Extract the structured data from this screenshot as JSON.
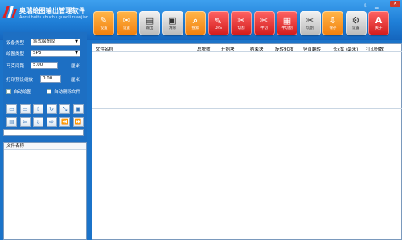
{
  "app": {
    "title": "奥瑞绘图输出管理软件",
    "subtitle": "Aorui huitu shuchu guanli ruanjian"
  },
  "window": {
    "close_label": "✕",
    "minimize_label": "▁",
    "extra_label": "⇩"
  },
  "toolbar": [
    {
      "label": "设置",
      "icon": "✎",
      "color": "orange"
    },
    {
      "label": "设置",
      "icon": "✉",
      "color": "orange"
    },
    {
      "label": "输出",
      "icon": "▤",
      "color": "gray"
    },
    {
      "label": "清除",
      "icon": "▣",
      "color": "gray"
    },
    {
      "label": "搜索",
      "icon": "⌕",
      "color": "orange"
    },
    {
      "label": "DPS",
      "icon": "✎",
      "color": "red"
    },
    {
      "label": "切割",
      "icon": "✂",
      "color": "red"
    },
    {
      "label": "半切",
      "icon": "✂",
      "color": "red"
    },
    {
      "label": "半切割",
      "icon": "▦",
      "color": "red"
    },
    {
      "label": "切割",
      "icon": "✂",
      "color": "gray"
    },
    {
      "label": "保存",
      "icon": "⇩",
      "color": "orange"
    },
    {
      "label": "设置",
      "icon": "⚙",
      "color": "gray"
    },
    {
      "label": "关于",
      "icon": "A",
      "color": "red"
    }
  ],
  "left": {
    "device_type_label": "设备类型",
    "device_type_value": "笔式绘图仪",
    "format_label": "绘图类型",
    "format_value": "SP3",
    "margin_label": "马克间距",
    "margin_value": "5.00",
    "margin_unit": "厘米",
    "preview_label": "打印预设缩放",
    "preview_value": "0.00",
    "preview_unit": "厘米",
    "auto_plot_label": "自动绘图",
    "auto_delete_label": "自动删除文件",
    "icon_buttons_row1": [
      "▭",
      "▭",
      "⇧",
      "↻",
      "⤡",
      "▣"
    ],
    "icon_buttons_row2": [
      "▤",
      "⇦",
      "⇩",
      "⇨",
      "⏪",
      "⏩"
    ],
    "filelist_header": "文件名称"
  },
  "main": {
    "columns": [
      "文件名称",
      "总块数",
      "开始块",
      "结束块",
      "旋转90度",
      "竖直翻转",
      "长x宽 (毫米)",
      "打印份数"
    ]
  }
}
